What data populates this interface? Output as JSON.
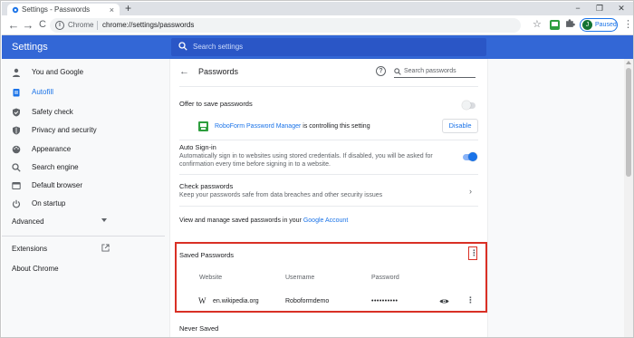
{
  "window": {
    "tab_title": "Settings - Passwords",
    "tab_close": "×",
    "new_tab": "+",
    "minimize": "−",
    "restore": "❐",
    "close": "✕"
  },
  "toolbar": {
    "back": "←",
    "forward": "→",
    "reload": "C",
    "site_label": "Chrome",
    "url": "chrome://settings/passwords",
    "star": "☆",
    "profile_initial": "J",
    "profile_status": "Paused",
    "menu": "⋮"
  },
  "header": {
    "title": "Settings",
    "search_placeholder": "Search settings"
  },
  "sidebar": {
    "items": [
      {
        "label": "You and Google",
        "icon": "person-icon"
      },
      {
        "label": "Autofill",
        "icon": "clipboard-icon",
        "active": true
      },
      {
        "label": "Safety check",
        "icon": "shield-check-icon"
      },
      {
        "label": "Privacy and security",
        "icon": "shield-icon"
      },
      {
        "label": "Appearance",
        "icon": "palette-icon"
      },
      {
        "label": "Search engine",
        "icon": "search-icon"
      },
      {
        "label": "Default browser",
        "icon": "browser-icon"
      },
      {
        "label": "On startup",
        "icon": "power-icon"
      }
    ],
    "advanced": "Advanced",
    "extensions": "Extensions",
    "about": "About Chrome"
  },
  "passwords": {
    "title": "Passwords",
    "help": "?",
    "search_placeholder": "Search passwords",
    "offer_label": "Offer to save passwords",
    "offer_enabled": false,
    "roboform_link": "RoboForm Password Manager",
    "roboform_suffix": " is controlling this setting",
    "disable_button": "Disable",
    "auto_signin_label": "Auto Sign-in",
    "auto_signin_desc_1": "Automatically sign in to websites using stored credentials. If disabled, you will be asked for",
    "auto_signin_desc_2": "confirmation every time before signing in to a website.",
    "auto_signin_enabled": true,
    "check_label": "Check passwords",
    "check_desc": "Keep your passwords safe from data breaches and other security issues",
    "check_chevron": "›",
    "manage_prefix": "View and manage saved passwords in your ",
    "manage_link": "Google Account",
    "saved_title": "Saved Passwords",
    "columns": {
      "website": "Website",
      "username": "Username",
      "password": "Password"
    },
    "entries": [
      {
        "favicon": "W",
        "website": "en.wikipedia.org",
        "username": "Roboformdemo",
        "password": "••••••••••"
      }
    ],
    "kebab": "⋮",
    "never_saved": "Never Saved"
  },
  "colors": {
    "header_blue": "#3367d6",
    "link_blue": "#1a73e8",
    "highlight_red": "#d93025",
    "roboform_green": "#2e9e3e"
  }
}
